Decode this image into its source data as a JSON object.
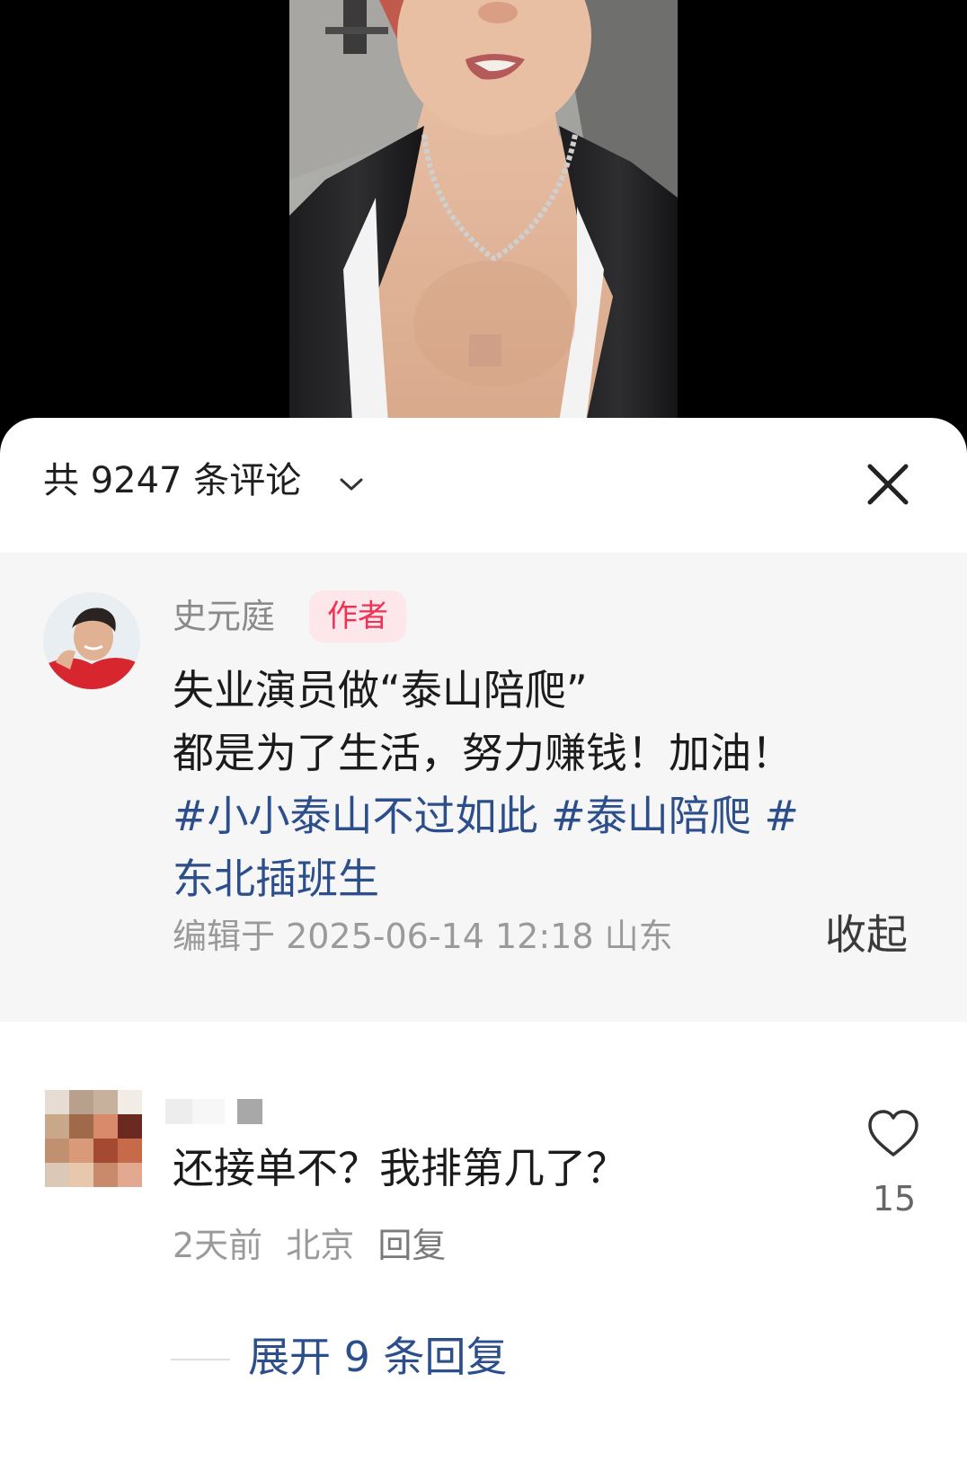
{
  "panel": {
    "count_label": "共 9247 条评论",
    "dropdown_icon": "chevron-down-icon",
    "close_icon": "close-icon"
  },
  "author_comment": {
    "name": "史元庭",
    "badge": "作者",
    "text_line1": "失业演员做“泰山陪爬”",
    "text_line2": "都是为了生活，努力赚钱！加油！",
    "hashtag1": "#小小泰山不过如此",
    "hashtag2": "#泰山陪爬",
    "hashtag3_start": "#",
    "hashtag3_end": "东北插班生",
    "edit_meta": "编辑于 2025-06-14 12:18 山东",
    "collapse_label": "收起"
  },
  "reply_comment": {
    "text": "还接单不？我排第几了？",
    "time": "2天前",
    "location": "北京",
    "reply_label": "回复",
    "like_icon": "heart-outline-icon",
    "like_count": "15",
    "expand_label": "展开 9 条回复"
  },
  "colors": {
    "hashtag": "#2c4f8c",
    "badge_text": "#ee3355",
    "badge_bg": "#fde7ea",
    "author_block_bg": "#f6f6f6",
    "meta_text": "#9a9a9a"
  }
}
